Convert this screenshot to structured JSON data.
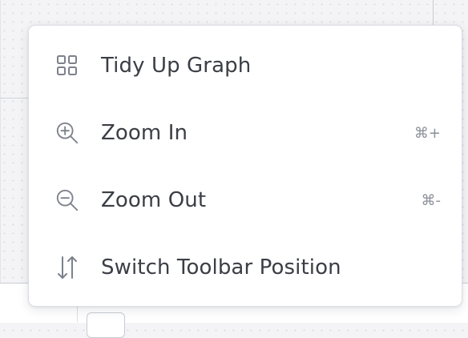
{
  "menu": {
    "items": [
      {
        "label": "Tidy Up Graph",
        "shortcut": "",
        "icon": "grid-icon"
      },
      {
        "label": "Zoom In",
        "shortcut": "⌘+",
        "icon": "zoom-in-icon"
      },
      {
        "label": "Zoom Out",
        "shortcut": "⌘-",
        "icon": "zoom-out-icon"
      },
      {
        "label": "Switch Toolbar Position",
        "shortcut": "",
        "icon": "swap-vertical-icon"
      }
    ]
  },
  "colors": {
    "text": "#3b3e45",
    "icon": "#7d818b",
    "shortcut": "#8c9099",
    "canvas": "#f4f4f6"
  }
}
